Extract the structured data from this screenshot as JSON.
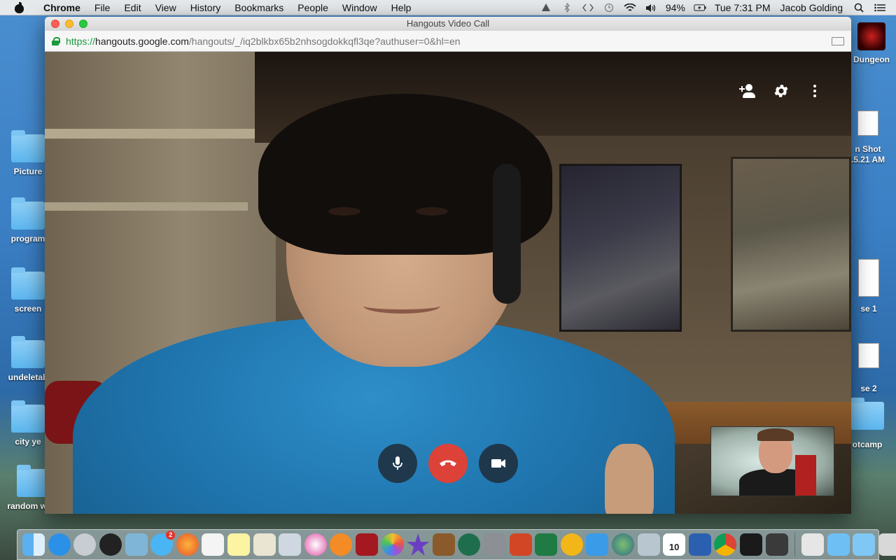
{
  "menubar": {
    "app": "Chrome",
    "items": [
      "File",
      "Edit",
      "View",
      "History",
      "Bookmarks",
      "People",
      "Window",
      "Help"
    ],
    "battery": "94%",
    "clock": "Tue 7:31 PM",
    "user": "Jacob Golding",
    "status_icons": [
      "time-machine-icon",
      "bluetooth-icon",
      "code-icon",
      "history-icon",
      "wifi-icon",
      "volume-icon",
      "battery-icon",
      "search-icon",
      "list-icon"
    ]
  },
  "desktop": {
    "left_icons": [
      "Picture",
      "program",
      "screen",
      "undeletab",
      "city ye",
      "random work"
    ],
    "right_icons": [
      "Dungeon",
      "n Shot",
      ".5.21 AM",
      "se 1",
      "se 2",
      "otcamp"
    ]
  },
  "window": {
    "title": "Hangouts Video Call",
    "url_scheme": "https://",
    "url_host": "hangouts.google.com",
    "url_path": "/hangouts/_/iq2blkbx65b2nhsogdokkqfl3qe?authuser=0&hl=en"
  },
  "call": {
    "controls_top": [
      "add-person-icon",
      "gear-icon",
      "more-icon"
    ],
    "controls_bottom": [
      "microphone-icon",
      "hang-up-icon",
      "camera-icon"
    ],
    "colors": {
      "hangup": "#dd4238",
      "control_bg": "#1e2c38"
    }
  },
  "dock": {
    "calendar_date": "10",
    "messages_badge": "2",
    "items": [
      "finder-icon",
      "app-store-icon",
      "launchpad-icon",
      "dashboard-icon",
      "preview-icon",
      "messages-icon",
      "firefox-icon",
      "reminders-icon",
      "notes-icon",
      "photos-icon",
      "mail-icon",
      "itunes-icon",
      "ibooks-icon",
      "photo-booth-icon",
      "photos-app-icon",
      "imovie-icon",
      "garageband-icon",
      "time-machine-icon",
      "system-preferences-icon",
      "powerpoint-icon",
      "excel-icon",
      "outlook-icon",
      "messenger-icon",
      "globe-icon",
      "directory-utility-icon",
      "calendar-icon",
      "word-icon",
      "chrome-icon",
      "terminal-icon",
      "sublime-icon",
      "folder-icon",
      "applications-icon",
      "downloads-icon",
      "screenshot-icon",
      "trash-icon"
    ]
  }
}
